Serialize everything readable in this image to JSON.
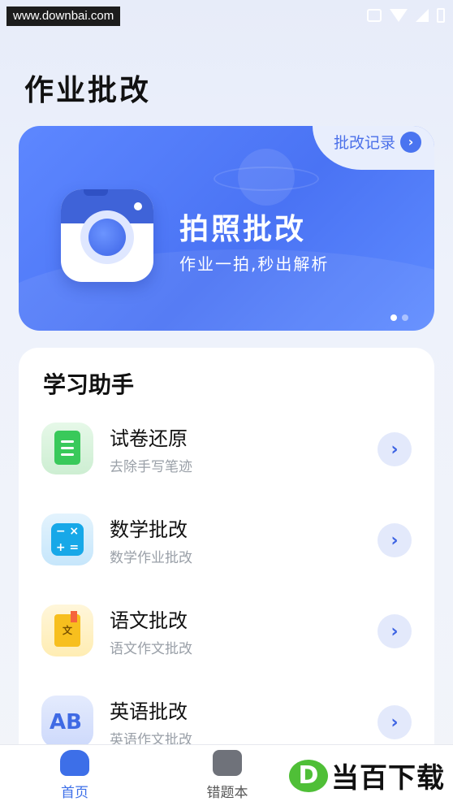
{
  "watermark_top": "www.downbai.com",
  "page": {
    "title": "作业批改"
  },
  "banner": {
    "record_link": "批改记录",
    "title": "拍照批改",
    "subtitle": "作业一拍,秒出解析"
  },
  "assistant": {
    "heading": "学习助手",
    "items": [
      {
        "label": "试卷还原",
        "desc": "去除手写笔迹",
        "icon": "paper-restore-icon"
      },
      {
        "label": "数学批改",
        "desc": "数学作业批改",
        "icon": "math-icon"
      },
      {
        "label": "语文批改",
        "desc": "语文作文批改",
        "icon": "chinese-book-icon"
      },
      {
        "label": "英语批改",
        "desc": "英语作文批改",
        "icon": "english-ab-icon"
      }
    ]
  },
  "tabbar": {
    "tabs": [
      {
        "label": "首页",
        "active": true
      },
      {
        "label": "错题本",
        "active": false
      }
    ]
  },
  "watermark_bottom": {
    "logo": "D",
    "text": "当百下载"
  },
  "colors": {
    "accent": "#4a73f4",
    "text": "#111111",
    "muted": "#9aa0a8"
  }
}
